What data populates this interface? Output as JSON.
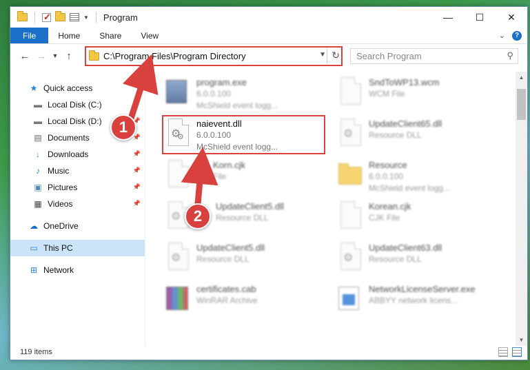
{
  "titlebar": {
    "title": "Program"
  },
  "ribbon": {
    "tabs": [
      "File",
      "Home",
      "Share",
      "View"
    ]
  },
  "address": {
    "path": "C:\\Program Files\\Program Directory"
  },
  "search": {
    "placeholder": "Search Program"
  },
  "sidebar": {
    "items": [
      {
        "label": "Quick access",
        "icon": "star-icon"
      },
      {
        "label": "Local Disk (C:)",
        "icon": "drive-icon"
      },
      {
        "label": "Local Disk (D:)",
        "icon": "drive-icon"
      },
      {
        "label": "Documents",
        "icon": "documents-icon"
      },
      {
        "label": "Downloads",
        "icon": "download-icon"
      },
      {
        "label": "Music",
        "icon": "music-icon"
      },
      {
        "label": "Pictures",
        "icon": "pictures-icon"
      },
      {
        "label": "Videos",
        "icon": "videos-icon"
      },
      {
        "label": "OneDrive",
        "icon": "cloud-icon"
      },
      {
        "label": "This PC",
        "icon": "computer-icon"
      },
      {
        "label": "Network",
        "icon": "network-icon"
      }
    ]
  },
  "files": [
    {
      "name": "program.exe",
      "line2": "6.0.0.100",
      "line3": "McShield event logg..."
    },
    {
      "name": "SndToWP13.wcm",
      "line2": "WCM File",
      "line3": ""
    },
    {
      "name": "naievent.dll",
      "line2": "6.0.0.100",
      "line3": "McShield event logg..."
    },
    {
      "name": "UpdateClient65.dll",
      "line2": "Resource DLL",
      "line3": ""
    },
    {
      "name": "Korn.cjk",
      "line2": "File",
      "line3": ""
    },
    {
      "name": "Resource",
      "line2": "6.0.0.100",
      "line3": "McShield event logg..."
    },
    {
      "name": "UpdateClient5.dll",
      "line2": "Resource DLL",
      "line3": ""
    },
    {
      "name": "Korean.cjk",
      "line2": "CJK File",
      "line3": ""
    },
    {
      "name": "UpdateClient5.dll",
      "line2": "Resource DLL",
      "line3": ""
    },
    {
      "name": "UpdateClient63.dll",
      "line2": "Resource DLL",
      "line3": ""
    },
    {
      "name": "certificates.cab",
      "line2": "WinRAR Archive",
      "line3": ""
    },
    {
      "name": "NetworkLicenseServer.exe",
      "line2": "ABBYY network licens...",
      "line3": ""
    }
  ],
  "status": {
    "count": "119 items"
  },
  "callouts": {
    "one": "1",
    "two": "2"
  },
  "colors": {
    "highlight": "#d8413d",
    "accent": "#1a6fc9"
  }
}
